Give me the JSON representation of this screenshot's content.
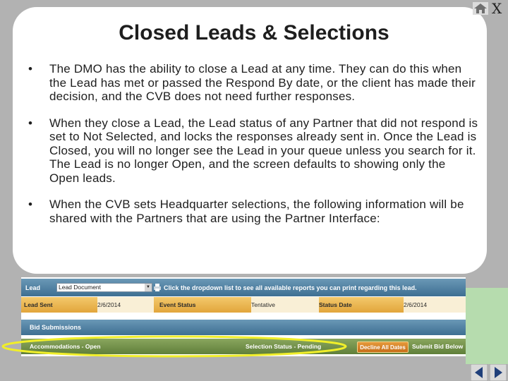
{
  "slide": {
    "title": "Closed Leads & Selections",
    "bullet_char": "•",
    "bullets": [
      "The DMO has the ability to close a Lead at any time. They can do this when the Lead has met or passed the Respond By date, or the client has made their decision, and the CVB does not need further responses.",
      "When they close a Lead, the Lead status of any Partner that did not respond is set to Not Selected, and locks the responses already sent in.  Once the Lead is Closed, you will no longer see the Lead in your queue unless you search for it. The Lead is no longer Open, and the screen defaults to showing only the Open leads.",
      "When the CVB sets Headquarter selections, the following information will be shared with the Partners that are using the Partner Interface:"
    ],
    "close_label": "X"
  },
  "app": {
    "lead_label": "Lead",
    "lead_select_value": "Lead Document",
    "lead_hint": "Click the dropdown list to see all available reports you can print regarding this lead.",
    "lead_sent_label": "Lead Sent",
    "lead_sent_value": "2/6/2014",
    "event_status_label": "Event Status",
    "event_status_value": "Tentative",
    "status_date_label": "Status Date",
    "status_date_value": "2/6/2014",
    "bid_submissions_label": "Bid Submissions",
    "accommodations_label": "Accommodations - Open",
    "selection_status_label": "Selection Status - Pending",
    "decline_button": "Decline All Dates",
    "submit_label": "Submit Bid Below"
  },
  "icons": {
    "home": "home-icon",
    "print": "print-icon",
    "prev": "prev-arrow-icon",
    "next": "next-arrow-icon"
  },
  "colors": {
    "header_bar": "#4f7fa1",
    "lead_row": "#eab24c",
    "section_bar": "#6d8d48",
    "highlight_ellipse": "#f0ee2a",
    "nav_green": "#b6dcae"
  }
}
